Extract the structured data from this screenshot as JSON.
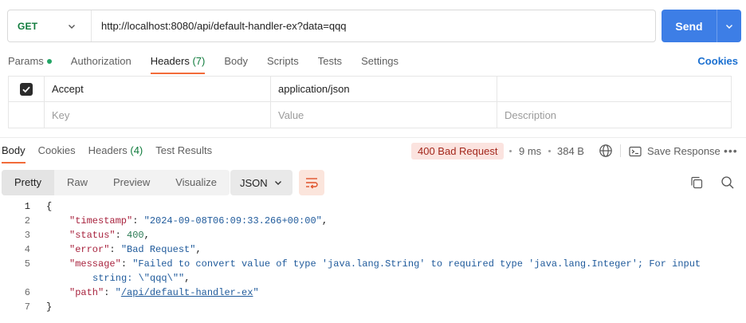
{
  "request": {
    "method": "GET",
    "url": "http://localhost:8080/api/default-handler-ex?data=qqq",
    "send_label": "Send"
  },
  "request_tabs": [
    {
      "label": "Params",
      "has_dot": true
    },
    {
      "label": "Authorization"
    },
    {
      "label": "Headers",
      "count": "(7)",
      "active": true
    },
    {
      "label": "Body"
    },
    {
      "label": "Scripts"
    },
    {
      "label": "Tests"
    },
    {
      "label": "Settings"
    }
  ],
  "cookies_label": "Cookies",
  "headers_table": {
    "rows": [
      {
        "checked": true,
        "key": "Accept",
        "value": "application/json",
        "description": ""
      }
    ],
    "placeholders": {
      "key": "Key",
      "value": "Value",
      "description": "Description"
    }
  },
  "response_tabs": [
    {
      "label": "Body",
      "active": true
    },
    {
      "label": "Cookies"
    },
    {
      "label": "Headers",
      "count": "(4)"
    },
    {
      "label": "Test Results"
    }
  ],
  "response_meta": {
    "status": "400 Bad Request",
    "time": "9 ms",
    "size": "384 B",
    "save_label": "Save Response",
    "status_color": "#a3271c"
  },
  "view_modes": [
    "Pretty",
    "Raw",
    "Preview",
    "Visualize"
  ],
  "active_view": "Pretty",
  "format": "JSON",
  "code": {
    "line_numbers": [
      "1",
      "2",
      "3",
      "4",
      "5",
      "6",
      "7"
    ],
    "open_brace": "{",
    "close_brace": "}",
    "fields": {
      "timestamp": {
        "key": "\"timestamp\"",
        "value": "\"2024-09-08T06:09:33.266+00:00\""
      },
      "status": {
        "key": "\"status\"",
        "value": "400"
      },
      "error": {
        "key": "\"error\"",
        "value": "\"Bad Request\""
      },
      "message": {
        "key": "\"message\"",
        "value_line1": "\"Failed to convert value of type 'java.lang.String' to required type 'java.lang.Integer'; For input",
        "value_line2": "string: \\\"qqq\\\"\""
      },
      "path": {
        "key": "\"path\"",
        "value_open": "\"",
        "value_link": "/api/default-handler-ex",
        "value_close": "\""
      }
    }
  },
  "colors": {
    "accent": "#f26b3a",
    "send_blue": "#3d7ee6",
    "method_green": "#0f7b3c",
    "json_key": "#a8233e",
    "json_string": "#1f5a9b",
    "json_number": "#2a7a54"
  }
}
